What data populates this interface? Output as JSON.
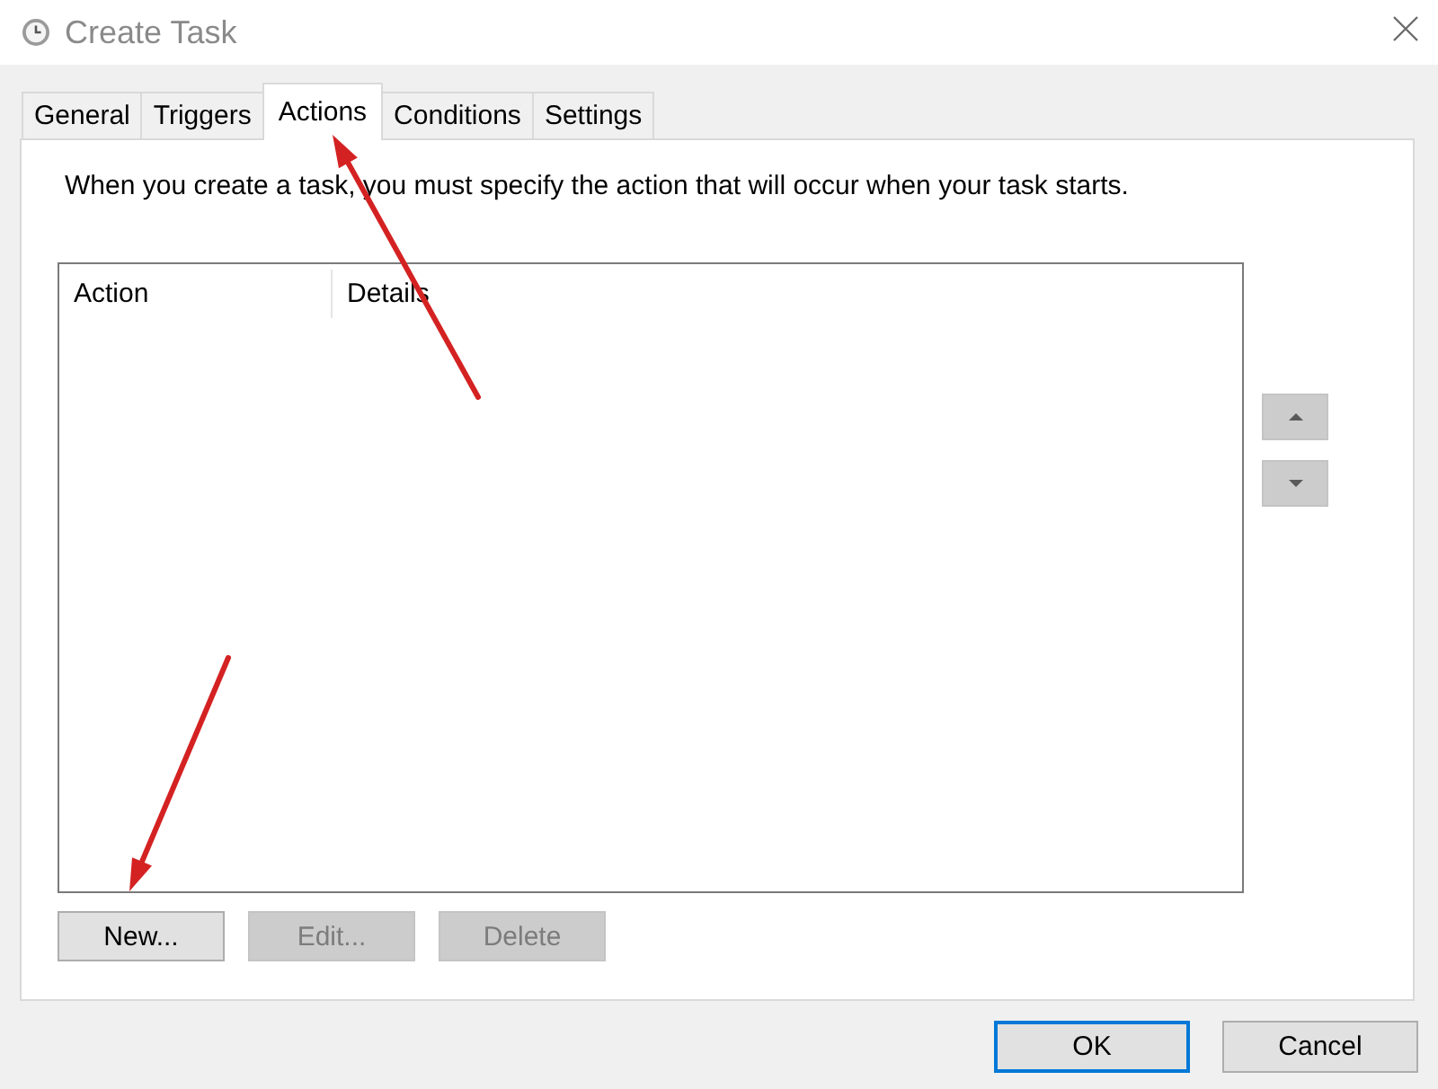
{
  "window": {
    "title": "Create Task"
  },
  "tabs": [
    {
      "label": "General",
      "selected": false
    },
    {
      "label": "Triggers",
      "selected": false
    },
    {
      "label": "Actions",
      "selected": true
    },
    {
      "label": "Conditions",
      "selected": false
    },
    {
      "label": "Settings",
      "selected": false
    }
  ],
  "description": "When you create a task, you must specify the action that will occur when your task starts.",
  "actions_table": {
    "columns": [
      "Action",
      "Details"
    ]
  },
  "move_buttons": [
    {
      "kind": "up",
      "disabled": true
    },
    {
      "kind": "down",
      "disabled": true
    }
  ],
  "action_buttons": [
    {
      "label": "New...",
      "disabled": false
    },
    {
      "label": "Edit...",
      "disabled": true
    },
    {
      "label": "Delete",
      "disabled": true
    }
  ],
  "dialog_buttons": [
    {
      "label": "OK",
      "default": true
    },
    {
      "label": "Cancel",
      "default": false
    }
  ]
}
